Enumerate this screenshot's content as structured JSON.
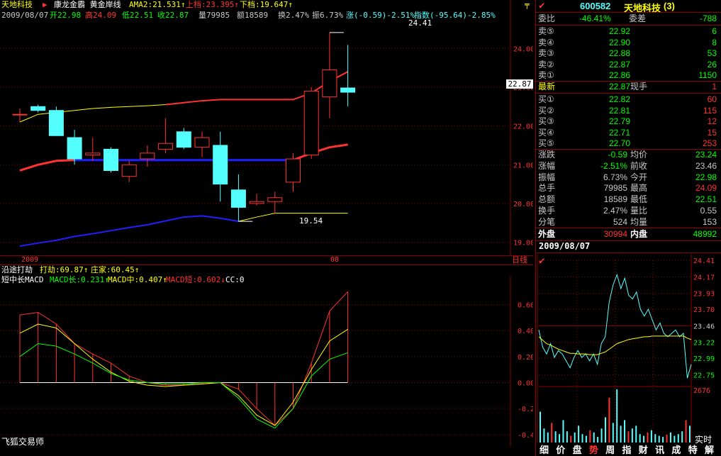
{
  "colors": {
    "up": "#ff3232",
    "down": "#54ffff",
    "neutral": "#c8c8c8",
    "yellow": "#ffff00",
    "green": "#00ff00",
    "blue": "#2020ff",
    "frame": "#8b0000",
    "white": "#ffffff",
    "orange": "#ffa500"
  },
  "header": {
    "stock_name": "天地科技",
    "arrow_icon": "triangle-right-icon",
    "indicator_name": "康龙金霸 黄金岸线",
    "ama2": "AMA2:21.531↑",
    "upper": "上档:23.395↑",
    "lower": "下档:19.647↑",
    "date": "2009/08/07",
    "open": "开22.98",
    "high": "高24.09",
    "low": "低22.51",
    "close": "收22.87",
    "volume": "量79985",
    "amount": "额18589",
    "turnover": "换2.47%",
    "amplitude": "振6.73%",
    "change": "涨(-0.59)-2.51%",
    "index": "指数(-95.64)-2.85%",
    "pin_icon": "pin-icon"
  },
  "main_chart": {
    "price_axis": [
      "24.00",
      "23.00",
      "22.00",
      "21.00",
      "20.00",
      "19.00"
    ],
    "current_price_tag": "22.87",
    "high_label": "24.41",
    "low_label": "19.54",
    "x_labels": [
      "2009",
      "08"
    ],
    "period_label": "日线"
  },
  "chart_data": {
    "type": "candlestick",
    "ylim": [
      18.7,
      24.7
    ],
    "candles": [
      {
        "o": 22.3,
        "h": 22.45,
        "l": 22.1,
        "c": 22.3
      },
      {
        "o": 22.5,
        "h": 22.55,
        "l": 22.35,
        "c": 22.4
      },
      {
        "o": 22.4,
        "h": 22.5,
        "l": 21.75,
        "c": 21.75
      },
      {
        "o": 21.7,
        "h": 21.9,
        "l": 21.0,
        "c": 21.15
      },
      {
        "o": 21.25,
        "h": 21.7,
        "l": 21.1,
        "c": 21.3
      },
      {
        "o": 21.4,
        "h": 21.45,
        "l": 20.8,
        "c": 20.85
      },
      {
        "o": 20.7,
        "h": 21.1,
        "l": 20.55,
        "c": 21.0
      },
      {
        "o": 21.15,
        "h": 21.5,
        "l": 20.95,
        "c": 21.3
      },
      {
        "o": 21.4,
        "h": 22.2,
        "l": 21.3,
        "c": 21.55
      },
      {
        "o": 21.85,
        "h": 21.95,
        "l": 21.4,
        "c": 21.45
      },
      {
        "o": 21.45,
        "h": 21.85,
        "l": 21.2,
        "c": 21.7
      },
      {
        "o": 21.5,
        "h": 21.85,
        "l": 20.05,
        "c": 20.5
      },
      {
        "o": 20.35,
        "h": 20.75,
        "l": 19.54,
        "c": 19.9
      },
      {
        "o": 20.0,
        "h": 20.25,
        "l": 19.95,
        "c": 20.05
      },
      {
        "o": 20.05,
        "h": 20.3,
        "l": 19.75,
        "c": 20.15
      },
      {
        "o": 20.55,
        "h": 21.3,
        "l": 20.3,
        "c": 21.15
      },
      {
        "o": 21.25,
        "h": 23.0,
        "l": 21.15,
        "c": 22.9
      },
      {
        "o": 22.75,
        "h": 24.41,
        "l": 22.2,
        "c": 23.45
      },
      {
        "o": 22.98,
        "h": 24.09,
        "l": 22.51,
        "c": 22.87
      }
    ],
    "upper_band": [
      22.1,
      22.3,
      22.35,
      22.4,
      22.45,
      22.48,
      22.5,
      22.52,
      22.55,
      22.6,
      22.65,
      22.68,
      22.68,
      22.68,
      22.68,
      22.68,
      22.85,
      23.15,
      23.4
    ],
    "mid_line": [
      20.85,
      21.0,
      21.1,
      21.12,
      21.12,
      21.12,
      21.12,
      21.12,
      21.12,
      21.12,
      21.12,
      21.12,
      21.12,
      21.12,
      21.12,
      21.12,
      21.3,
      21.45,
      21.52
    ],
    "lower_band": [
      18.9,
      18.98,
      19.05,
      19.15,
      19.22,
      19.3,
      19.38,
      19.45,
      19.55,
      19.65,
      19.68,
      19.62,
      19.54,
      19.65,
      19.75,
      19.75,
      19.75,
      19.75,
      19.75
    ],
    "macd": {
      "ylim": [
        -0.45,
        0.75
      ],
      "ticks": [
        "0.60",
        "0.40",
        "0.20",
        "0.00",
        "-0.20",
        "-0.40"
      ],
      "long": [
        0.52,
        0.54,
        0.45,
        0.3,
        0.22,
        0.15,
        0.05,
        0.0,
        -0.02,
        -0.02,
        -0.01,
        0.0,
        -0.05,
        -0.2,
        -0.33,
        -0.2,
        0.15,
        0.55,
        0.7
      ],
      "mid": [
        0.38,
        0.45,
        0.42,
        0.3,
        0.18,
        0.08,
        0.01,
        -0.02,
        -0.03,
        -0.02,
        -0.01,
        0.0,
        -0.1,
        -0.25,
        -0.33,
        -0.15,
        0.1,
        0.32,
        0.41
      ],
      "short": [
        0.2,
        0.3,
        0.28,
        0.22,
        0.15,
        0.07,
        0.02,
        0.0,
        -0.01,
        -0.01,
        0.0,
        0.0,
        -0.12,
        -0.28,
        -0.35,
        -0.2,
        0.05,
        0.18,
        0.23
      ],
      "bars": [
        0.52,
        0.54,
        0.45,
        0.3,
        0.22,
        0.15,
        0.05,
        0.0,
        -0.02,
        -0.02,
        -0.01,
        0.0,
        -0.05,
        -0.2,
        -0.33,
        -0.2,
        0.15,
        0.55,
        0.7
      ]
    }
  },
  "macd_panel": {
    "title": "沿途打劫",
    "dajie": "打劫:69.87↑",
    "zhuangjia": "庄家:60.45↑",
    "indicator": "短中长MACD",
    "long_label": "MACD长:0.231↑",
    "mid_label": "MACD中:0.407↑",
    "short_label": "MACD短:0.602↓",
    "cc_label": "CC:0",
    "footer": "飞狐交易师"
  },
  "quote_panel": {
    "check_icon": "check-icon",
    "code": "600582",
    "name": "天地科技",
    "suffix": "(3)",
    "ratio_label": "委比",
    "ratio_value": "-46.41%",
    "diff_label": "委差",
    "diff_value": "-788",
    "asks": [
      {
        "label": "卖⑤",
        "price": "22.92",
        "vol": "6"
      },
      {
        "label": "卖④",
        "price": "22.90",
        "vol": "8"
      },
      {
        "label": "卖③",
        "price": "22.88",
        "vol": "53"
      },
      {
        "label": "卖②",
        "price": "22.87",
        "vol": "26"
      },
      {
        "label": "卖①",
        "price": "22.86",
        "vol": "1150"
      }
    ],
    "last_label": "最新",
    "last_price": "22.87",
    "hand_label": "现手",
    "hand_value": "1",
    "bids": [
      {
        "label": "买①",
        "price": "22.82",
        "vol": "60"
      },
      {
        "label": "买②",
        "price": "22.81",
        "vol": "115"
      },
      {
        "label": "买③",
        "price": "22.79",
        "vol": "12"
      },
      {
        "label": "买④",
        "price": "22.71",
        "vol": "15"
      },
      {
        "label": "买⑤",
        "price": "22.70",
        "vol": "253"
      }
    ],
    "stats": [
      {
        "l1": "涨跌",
        "v1": "-0.59",
        "c1": "#00ff00",
        "l2": "均价",
        "v2": "23.24",
        "c2": "#00ff00"
      },
      {
        "l1": "涨幅",
        "v1": "-2.51%",
        "c1": "#00ff00",
        "l2": "前收",
        "v2": "23.46",
        "c2": "#c8c8c8"
      },
      {
        "l1": "振幅",
        "v1": "6.73%",
        "c1": "#c8c8c8",
        "l2": "今开",
        "v2": "22.98",
        "c2": "#00ff00"
      },
      {
        "l1": "总手",
        "v1": "79985",
        "c1": "#c8c8c8",
        "l2": "最高",
        "v2": "24.09",
        "c2": "#ff3232"
      },
      {
        "l1": "总额",
        "v1": "18589",
        "c1": "#c8c8c8",
        "l2": "最低",
        "v2": "22.51",
        "c2": "#00ff00"
      },
      {
        "l1": "换手",
        "v1": "2.47%",
        "c1": "#c8c8c8",
        "l2": "量比",
        "v2": "0.55",
        "c2": "#c8c8c8"
      },
      {
        "l1": "分笔",
        "v1": "524",
        "c1": "#c8c8c8",
        "l2": "均量",
        "v2": "153",
        "c2": "#c8c8c8"
      }
    ],
    "outer_label": "外盘",
    "outer_value": "30994",
    "inner_label": "内盘",
    "inner_value": "48992",
    "date": "2009/08/07"
  },
  "intraday": {
    "check_icon": "check-icon",
    "price_ticks": [
      "24.41",
      "24.17",
      "23.93",
      "23.70",
      "23.46",
      "23.22",
      "22.99",
      "22.75"
    ],
    "volume_tick": "2676",
    "realtime_label": "实时",
    "price_line": [
      23.4,
      23.15,
      23.05,
      23.2,
      23.0,
      23.1,
      23.05,
      22.95,
      22.85,
      23.0,
      23.1,
      23.0,
      23.05,
      22.95,
      23.05,
      22.9,
      23.2,
      23.3,
      23.8,
      24.05,
      24.2,
      24.0,
      24.15,
      23.9,
      23.85,
      23.95,
      23.7,
      23.6,
      23.7,
      23.55,
      23.4,
      23.5,
      23.35,
      23.3,
      23.35,
      23.4,
      23.3,
      23.35,
      22.7,
      22.9
    ],
    "avg_line": [
      23.3,
      23.25,
      23.2,
      23.18,
      23.15,
      23.12,
      23.1,
      23.08,
      23.06,
      23.06,
      23.05,
      23.05,
      23.05,
      23.04,
      23.04,
      23.04,
      23.06,
      23.08,
      23.12,
      23.16,
      23.2,
      23.22,
      23.24,
      23.26,
      23.27,
      23.28,
      23.29,
      23.3,
      23.3,
      23.31,
      23.31,
      23.31,
      23.31,
      23.31,
      23.31,
      23.31,
      23.31,
      23.31,
      23.28,
      23.26
    ],
    "volumes": [
      0.55,
      0.25,
      0.18,
      0.35,
      0.2,
      0.15,
      0.4,
      0.2,
      0.12,
      0.18,
      0.3,
      0.15,
      0.12,
      0.22,
      0.18,
      0.1,
      0.25,
      0.45,
      0.8,
      0.35,
      0.95,
      0.3,
      0.4,
      0.2,
      0.25,
      0.3,
      0.15,
      0.12,
      0.18,
      0.22,
      0.15,
      0.12,
      0.1,
      0.14,
      0.18,
      0.12,
      0.15,
      0.2,
      0.4,
      0.3
    ]
  },
  "tabs": [
    {
      "label": "细",
      "name": "tab-detail",
      "color": "#ffffff"
    },
    {
      "label": "价",
      "name": "tab-price",
      "color": "#ffffff"
    },
    {
      "label": "盘",
      "name": "tab-book",
      "color": "#ffffff"
    },
    {
      "label": "势",
      "name": "tab-trend",
      "color": "#ff3232"
    },
    {
      "label": "周",
      "name": "tab-week",
      "color": "#ffffff"
    },
    {
      "label": "指",
      "name": "tab-index",
      "color": "#ffffff"
    },
    {
      "label": "财",
      "name": "tab-finance",
      "color": "#ffffff"
    },
    {
      "label": "讯",
      "name": "tab-news",
      "color": "#ffffff"
    },
    {
      "label": "成",
      "name": "tab-trades",
      "color": "#ffffff"
    },
    {
      "label": "特",
      "name": "tab-special",
      "color": "#ffffff"
    },
    {
      "label": "解",
      "name": "tab-explain",
      "color": "#ffffff"
    }
  ]
}
